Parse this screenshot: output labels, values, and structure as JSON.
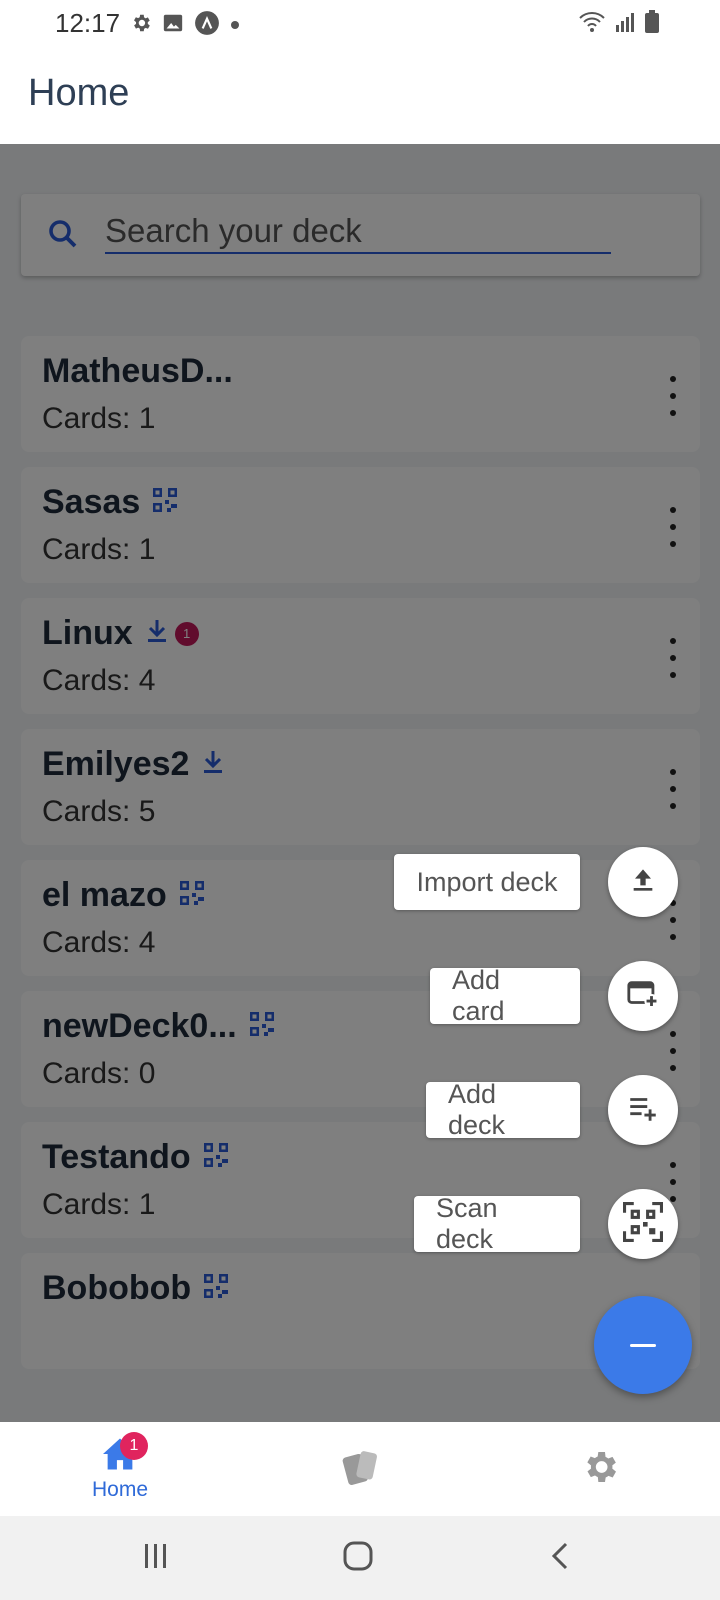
{
  "status_bar": {
    "time": "12:17",
    "left_icons": [
      "settings-icon",
      "image-icon",
      "app-icon",
      "dot-icon"
    ],
    "right_icons": [
      "wifi-icon",
      "signal-icon",
      "battery-icon"
    ]
  },
  "header": {
    "title": "Home"
  },
  "search": {
    "placeholder": "Search your deck",
    "value": ""
  },
  "decks": [
    {
      "title": "MatheusD...",
      "count": "Cards: 1",
      "icon": "",
      "badge": ""
    },
    {
      "title": "Sasas",
      "count": "Cards: 1",
      "icon": "qr-icon",
      "badge": ""
    },
    {
      "title": "Linux",
      "count": "Cards: 4",
      "icon": "download-icon",
      "badge": "1"
    },
    {
      "title": "Emilyes2",
      "count": "Cards: 5",
      "icon": "download-icon",
      "badge": ""
    },
    {
      "title": "el mazo",
      "count": "Cards: 4",
      "icon": "qr-icon",
      "badge": ""
    },
    {
      "title": "newDeck0...",
      "count": "Cards: 0",
      "icon": "qr-icon",
      "badge": ""
    },
    {
      "title": "Testando",
      "count": "Cards: 1",
      "icon": "qr-icon",
      "badge": ""
    },
    {
      "title": "Bobobob",
      "count": "",
      "icon": "qr-icon",
      "badge": ""
    }
  ],
  "fab_actions": [
    {
      "label": "Import deck",
      "icon": "upload-icon"
    },
    {
      "label": "Add card",
      "icon": "add-card-icon"
    },
    {
      "label": "Add deck",
      "icon": "add-list-icon"
    },
    {
      "label": "Scan deck",
      "icon": "qr-scan-icon"
    }
  ],
  "fab_main": {
    "icon": "minus-icon"
  },
  "bottom_nav": {
    "items": [
      {
        "label": "Home",
        "icon": "home-icon",
        "badge": "1",
        "active": true
      },
      {
        "label": "",
        "icon": "cards-icon",
        "active": false
      },
      {
        "label": "",
        "icon": "gear-icon",
        "active": false
      }
    ]
  },
  "colors": {
    "accent": "#2f6ad8",
    "fab": "#3b7ae8",
    "badge": "#e0245e",
    "title": "#2e3f55"
  }
}
